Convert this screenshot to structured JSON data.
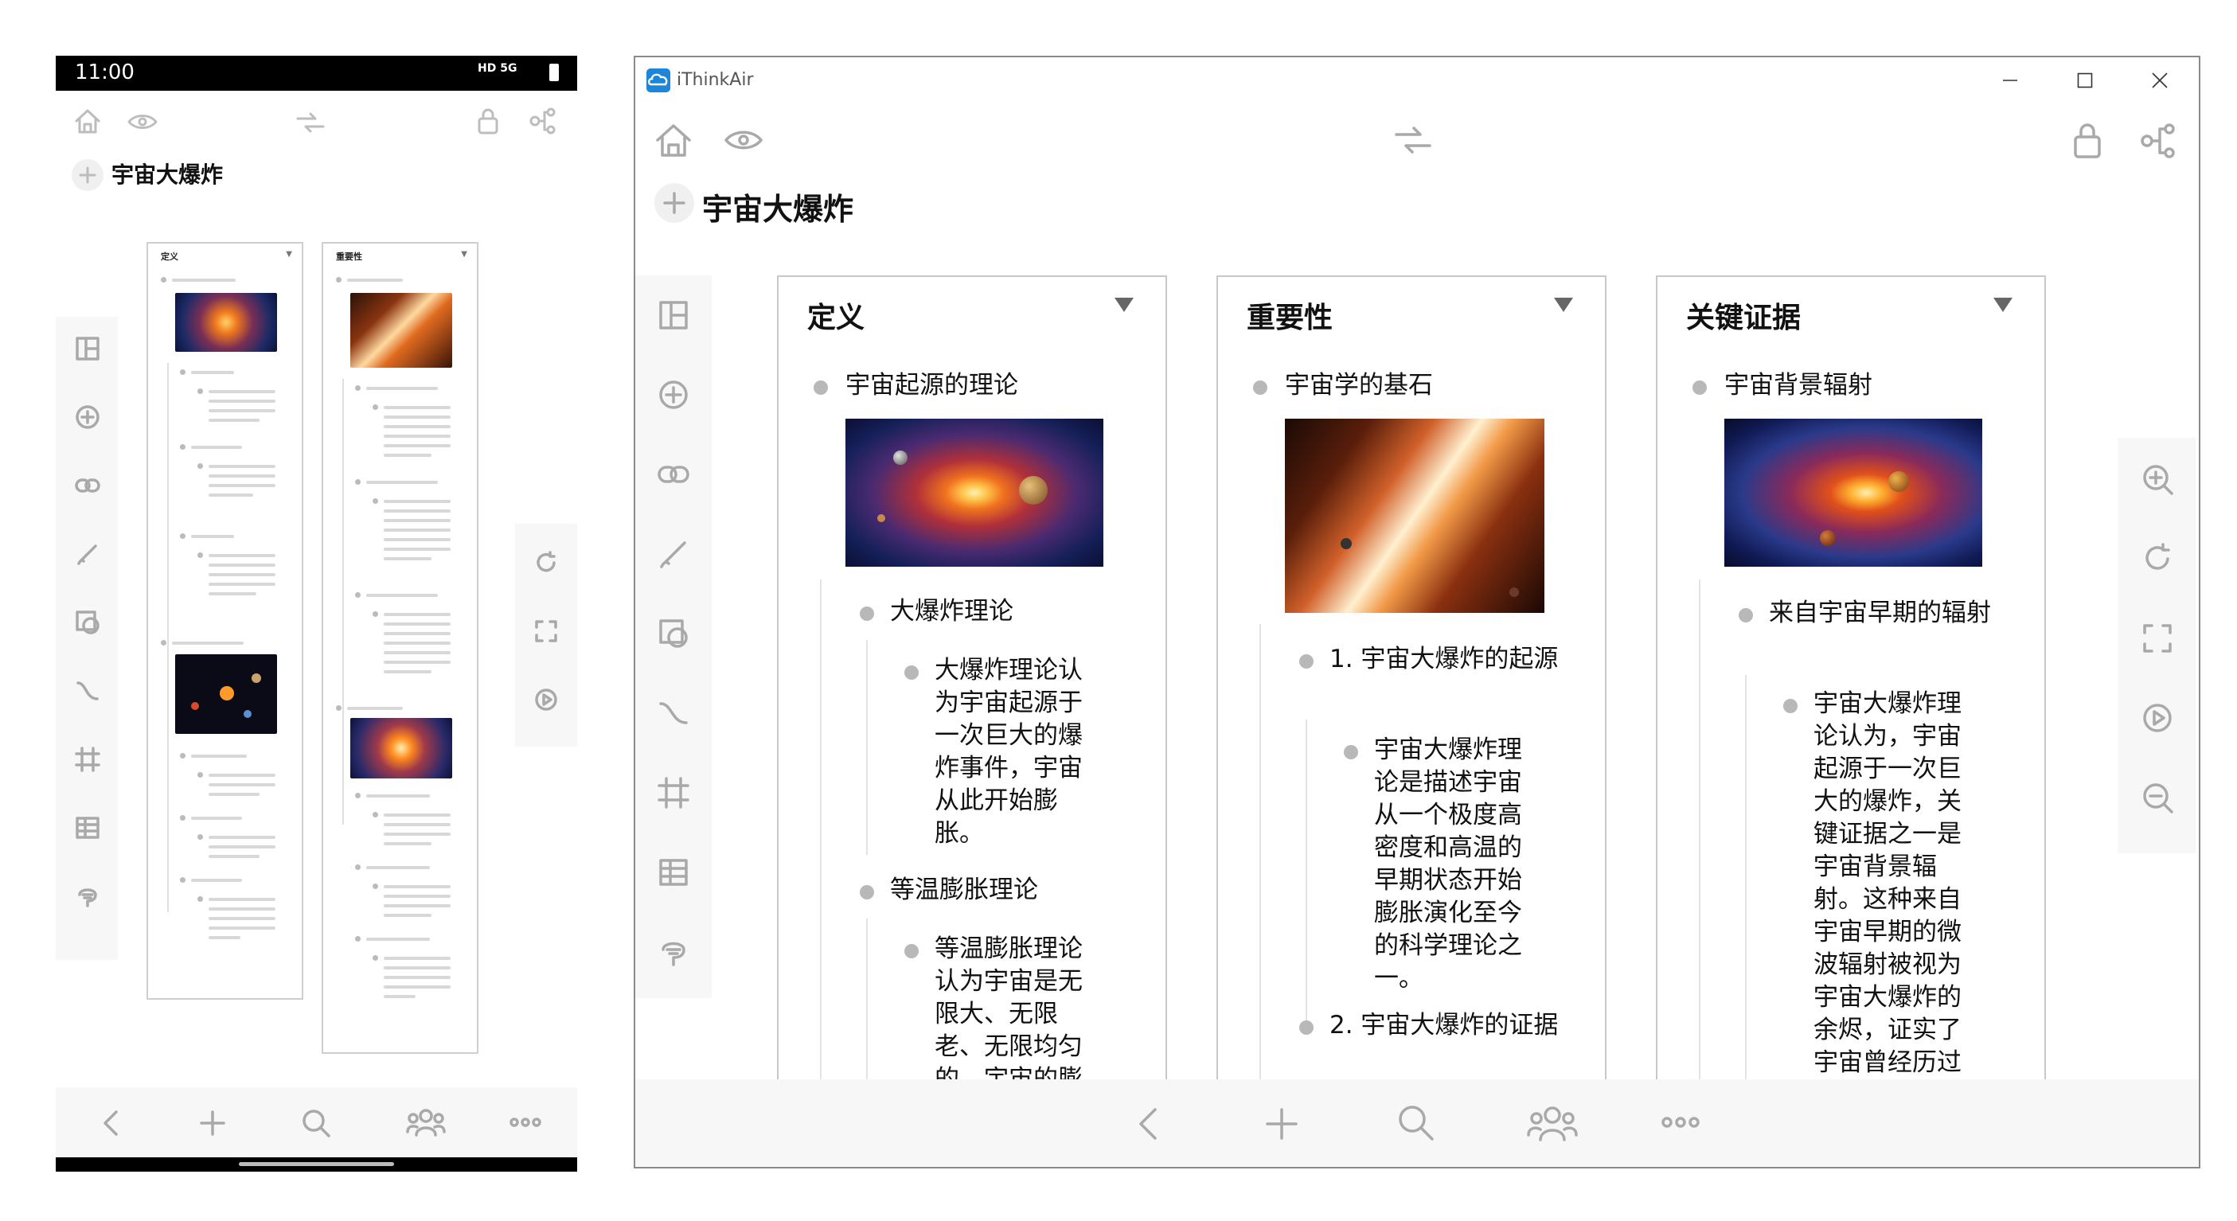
{
  "phone": {
    "time": "11:00",
    "status_icons": "HD 5G",
    "title": "宇宙大爆炸",
    "cards": [
      {
        "title": "定义"
      },
      {
        "title": "重要性"
      }
    ]
  },
  "window": {
    "app_name": "iThinkAir",
    "title": "宇宙大爆炸",
    "cards": [
      {
        "title": "定义",
        "root": "宇宙起源的理论",
        "children": [
          {
            "label": "大爆炸理论",
            "detail": "大爆炸理论认为宇宙起源于一次巨大的爆炸事件，宇宙从此开始膨胀。"
          },
          {
            "label": "等温膨胀理论",
            "detail": "等温膨胀理论认为宇宙是无限大、无限老、无限均匀的，宇宙的膨"
          }
        ]
      },
      {
        "title": "重要性",
        "root": "宇宙学的基石",
        "children": [
          {
            "label": "1. 宇宙大爆炸的起源",
            "detail": "宇宙大爆炸理论是描述宇宙从一个极度高密度和高温的早期状态开始膨胀演化至今的科学理论之一。"
          },
          {
            "label": "2. 宇宙大爆炸的证据",
            "detail": ""
          }
        ]
      },
      {
        "title": "关键证据",
        "root": "宇宙背景辐射",
        "children": [
          {
            "label": "来自宇宙早期的辐射",
            "detail": "宇宙大爆炸理论认为，宇宙起源于一次巨大的爆炸，关键证据之一是宇宙背景辐射。这种来自宇宙早期的微波辐射被视为宇宙大爆炸的余烬，证实了宇宙曾经历过一次炽热的"
          }
        ]
      }
    ]
  }
}
